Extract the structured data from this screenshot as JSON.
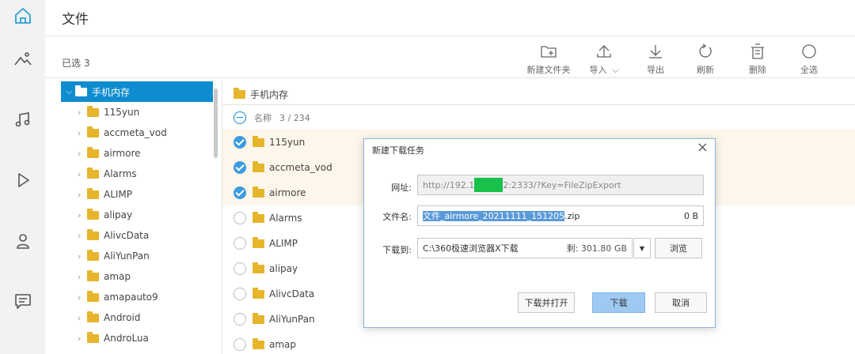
{
  "app": {
    "title": "文件"
  },
  "nav": [
    "home-icon",
    "photos-icon",
    "music-icon",
    "video-icon",
    "contacts-icon",
    "messages-icon"
  ],
  "header": {
    "selected_count": "已选 3"
  },
  "toolbar": [
    {
      "label": "新建文件夹",
      "icon": "new-folder-icon"
    },
    {
      "label": "导入",
      "icon": "import-icon"
    },
    {
      "label": "导出",
      "icon": "export-icon"
    },
    {
      "label": "刷新",
      "icon": "refresh-icon"
    },
    {
      "label": "删除",
      "icon": "delete-icon"
    },
    {
      "label": "全选",
      "icon": "select-all-icon"
    }
  ],
  "tree": {
    "root": "手机内存",
    "items": [
      "115yun",
      "accmeta_vod",
      "airmore",
      "Alarms",
      "ALIMP",
      "alipay",
      "AlivcData",
      "AliYunPan",
      "amap",
      "amapauto9",
      "Android",
      "AndroLua"
    ]
  },
  "list": {
    "breadcrumb": "手机内存",
    "column_name": "名称",
    "count": "3 / 234",
    "rows": [
      {
        "name": "115yun",
        "selected": true
      },
      {
        "name": "accmeta_vod",
        "selected": true
      },
      {
        "name": "airmore",
        "selected": true
      },
      {
        "name": "Alarms",
        "selected": false
      },
      {
        "name": "ALIMP",
        "selected": false
      },
      {
        "name": "alipay",
        "selected": false
      },
      {
        "name": "AlivcData",
        "selected": false
      },
      {
        "name": "AliYunPan",
        "selected": false
      },
      {
        "name": "amap",
        "selected": false
      }
    ]
  },
  "dialog": {
    "title": "新建下载任务",
    "url_label": "网址:",
    "url_prefix": "http://192.1",
    "url_suffix": "2:2333/?Key=FileZipExport",
    "filename_label": "文件名:",
    "filename_selected": "文件_airmore_20211111_151205",
    "filename_ext": ".zip",
    "filesize": "0 B",
    "saveto_label": "下载到:",
    "saveto_path": "C:\\360极速浏览器X下载",
    "free_space": "剩: 301.80 GB",
    "browse": "浏览",
    "download_open": "下载并打开",
    "download": "下载",
    "cancel": "取消"
  },
  "colors": {
    "accent": "#0d8ccf",
    "folder": "#e6b52c",
    "check": "#3b9be0"
  }
}
